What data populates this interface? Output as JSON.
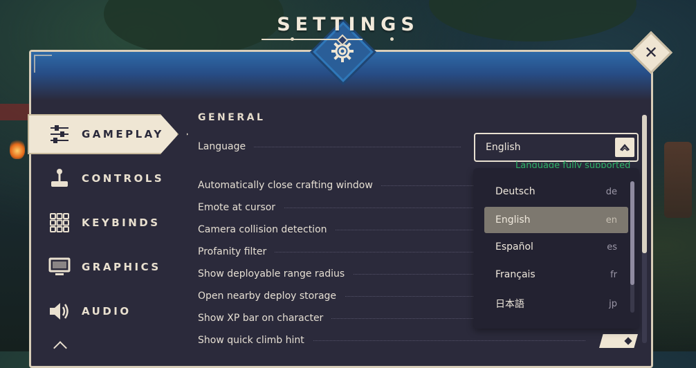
{
  "header": {
    "title": "SETTINGS"
  },
  "nav": {
    "items": [
      {
        "label": "GAMEPLAY",
        "icon": "sliders-icon",
        "active": true
      },
      {
        "label": "CONTROLS",
        "icon": "joystick-icon",
        "active": false
      },
      {
        "label": "KEYBINDS",
        "icon": "keypad-icon",
        "active": false
      },
      {
        "label": "GRAPHICS",
        "icon": "monitor-icon",
        "active": false
      },
      {
        "label": "AUDIO",
        "icon": "speaker-icon",
        "active": false
      }
    ]
  },
  "content": {
    "section_title": "GENERAL",
    "language": {
      "label": "Language",
      "selected": "English",
      "support_text": "Language fully supported"
    },
    "options": [
      {
        "label": "Automatically close crafting window"
      },
      {
        "label": "Emote at cursor"
      },
      {
        "label": "Camera collision detection"
      },
      {
        "label": "Profanity filter"
      },
      {
        "label": "Show deployable range radius"
      },
      {
        "label": "Open nearby deploy storage"
      },
      {
        "label": "Show XP bar on character"
      },
      {
        "label": "Show quick climb hint",
        "enabled": true
      }
    ]
  },
  "dropdown": {
    "options": [
      {
        "name": "Deutsch",
        "code": "de"
      },
      {
        "name": "English",
        "code": "en",
        "selected": true
      },
      {
        "name": "Español",
        "code": "es"
      },
      {
        "name": "Français",
        "code": "fr"
      },
      {
        "name": "日本語",
        "code": "jp"
      }
    ]
  },
  "colors": {
    "panel": "#2b2a3b",
    "accent_cream": "#efe6d4",
    "header_blue": "#2e6aa8",
    "support_green": "#2fb86a"
  }
}
